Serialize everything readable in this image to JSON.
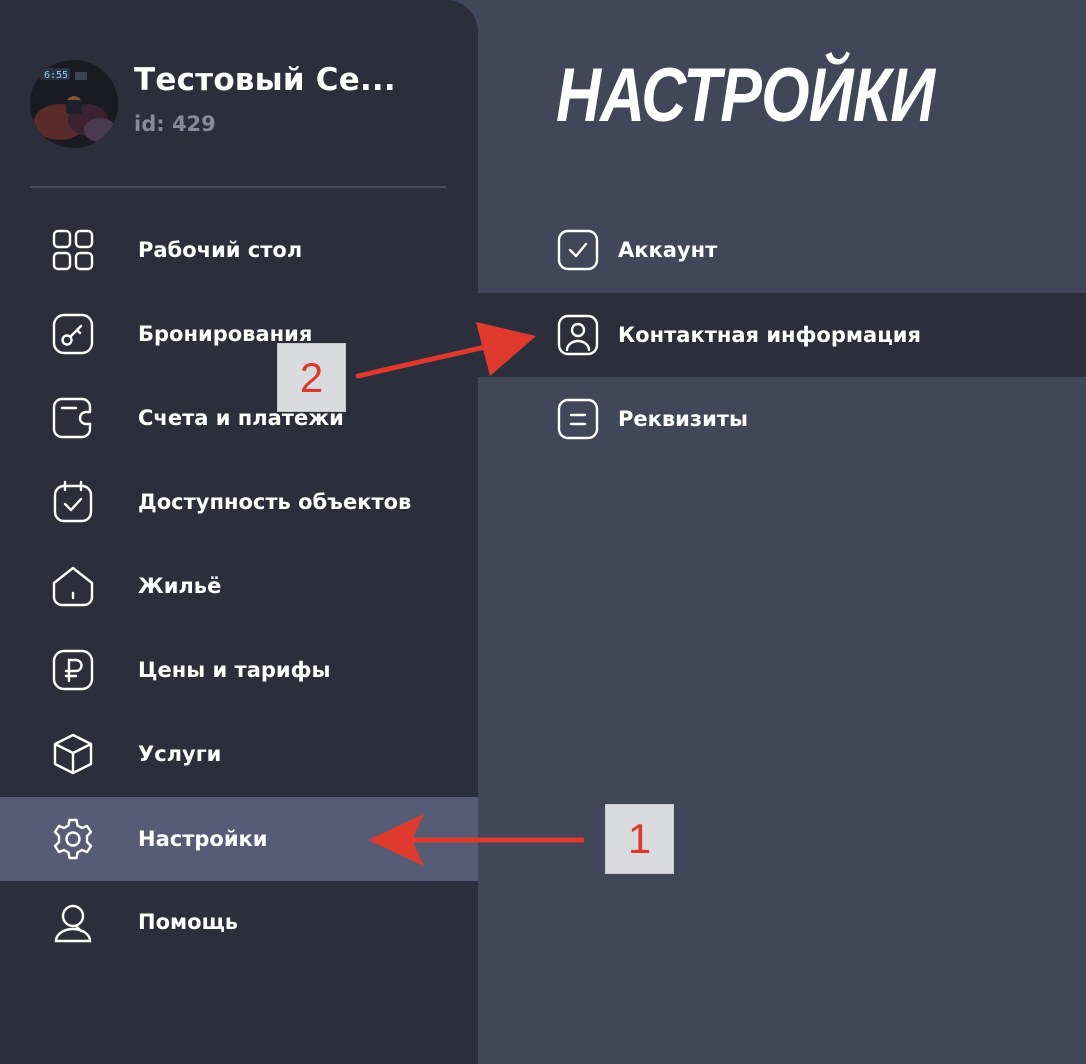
{
  "user": {
    "name": "Тестовый Се...",
    "id_label": "id: 429"
  },
  "sidebar": {
    "items": [
      {
        "label": "Рабочий стол",
        "icon": "grid-icon"
      },
      {
        "label": "Бронирования",
        "icon": "key-icon"
      },
      {
        "label": "Счета и платежи",
        "icon": "wallet-icon"
      },
      {
        "label": "Доступность объектов",
        "icon": "calendar-check-icon"
      },
      {
        "label": "Жильё",
        "icon": "home-icon"
      },
      {
        "label": "Цены и тарифы",
        "icon": "ruble-icon"
      },
      {
        "label": "Услуги",
        "icon": "box-icon"
      },
      {
        "label": "Настройки",
        "icon": "gear-icon",
        "active": true
      },
      {
        "label": "Помощь",
        "icon": "support-icon"
      }
    ]
  },
  "main": {
    "title": "НАСТРОЙКИ",
    "settings_items": [
      {
        "label": "Аккаунт",
        "icon": "check-square-icon"
      },
      {
        "label": "Контактная информация",
        "icon": "user-square-icon",
        "active": true
      },
      {
        "label": "Реквизиты",
        "icon": "list-square-icon"
      }
    ]
  },
  "annotations": {
    "callout_1": "1",
    "callout_2": "2"
  },
  "colors": {
    "sidebar_bg": "#2c2e3c",
    "main_bg": "#414659",
    "active_nav_bg": "#575c76",
    "arrow": "#e03a2f"
  }
}
